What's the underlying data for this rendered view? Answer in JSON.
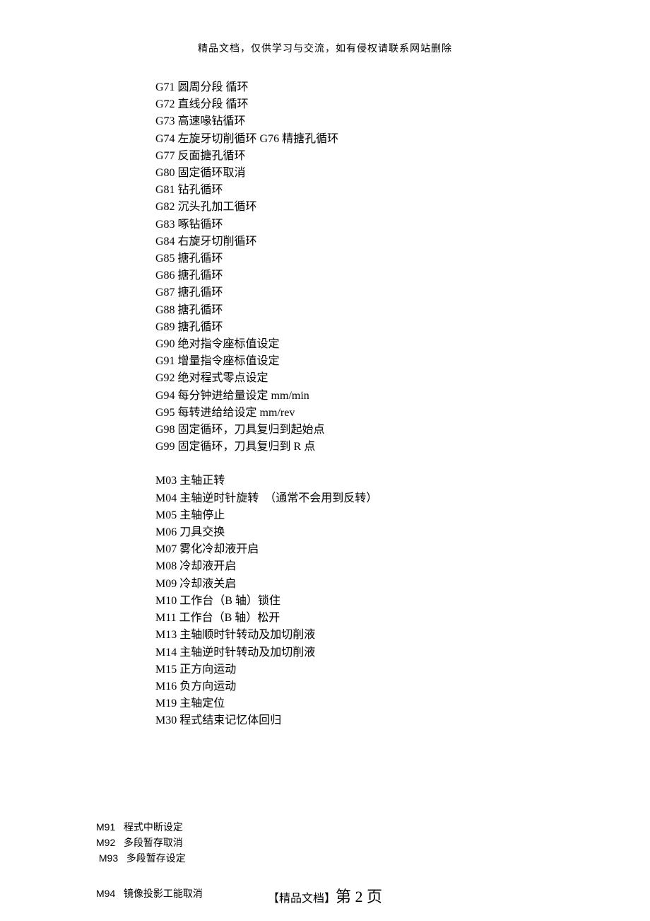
{
  "header": "精品文档，仅供学习与交流，如有侵权请联系网站删除",
  "gcodes": [
    "G71 圆周分段 循环",
    "G72 直线分段 循环",
    "G73 高速喙钻循环",
    "G74 左旋牙切削循环 G76 精搪孔循环",
    "G77 反面搪孔循环",
    "G80 固定循环取消",
    "G81 钻孔循环",
    "G82 沉头孔加工循环",
    "G83 啄钻循环",
    "G84 右旋牙切削循环",
    "G85 搪孔循环",
    "G86 搪孔循环",
    "G87 搪孔循环",
    "G88 搪孔循环",
    "G89 搪孔循环",
    "G90 绝对指令座标值设定",
    "G91 增量指令座标值设定",
    "G92 绝对程式零点设定",
    "G94 每分钟进给量设定 mm/min",
    "G95 每转进给给设定 mm/rev",
    "G98 固定循环，刀具复归到起始点",
    "G99 固定循环，刀具复归到 R 点"
  ],
  "mcodes": [
    "M03 主轴正转",
    "M04 主轴逆时针旋转  （通常不会用到反转）",
    "M05 主轴停止",
    "M06 刀具交换",
    "M07 雾化冷却液开启",
    "M08 冷却液开启",
    "M09 冷却液关启",
    "M10 工作台（B 轴）锁住",
    "M11 工作台（B 轴）松开",
    "M13 主轴顺时针转动及加切削液",
    "M14 主轴逆时针转动及加切削液",
    "M15 正方向运动",
    "M16 负方向运动",
    "M19 主轴定位",
    "M30 程式结束记忆体回归"
  ],
  "mcodes2": [
    {
      "code": "M91",
      "desc": "程式中断设定",
      "indent": 0
    },
    {
      "code": "M92",
      "desc": "多段暂存取消",
      "indent": 0
    },
    {
      "code": "M93",
      "desc": "多段暂存设定",
      "indent": 1
    }
  ],
  "mcodes3": [
    {
      "code": "M94",
      "desc": "镜像投影工能取消",
      "indent": 0
    }
  ],
  "footer": {
    "prefix": "【精品文档】",
    "page": "第 2 页"
  }
}
